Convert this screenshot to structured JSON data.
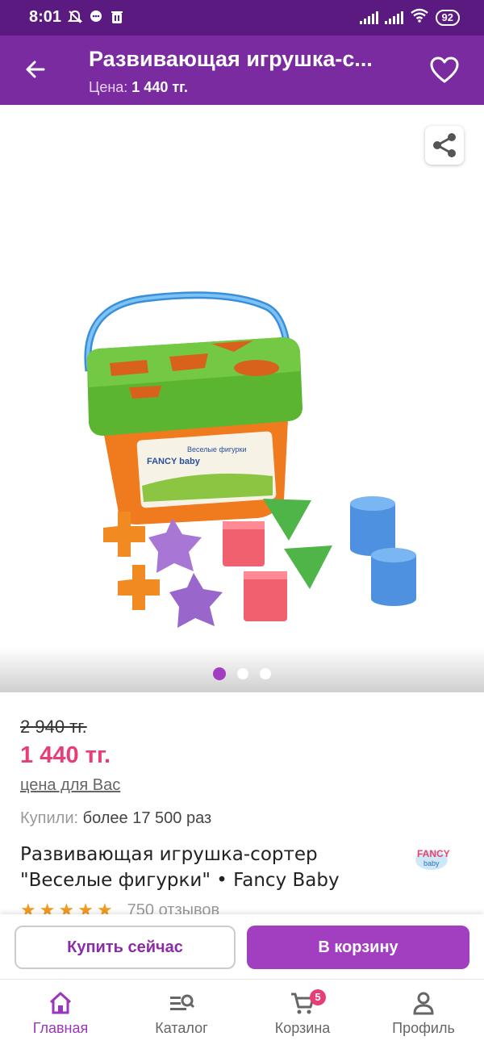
{
  "status_bar": {
    "time": "8:01",
    "battery": "92"
  },
  "header": {
    "title": "Развивающая игрушка-с...",
    "price_label": "Цена:",
    "price_value": "1 440 тг."
  },
  "gallery": {
    "image_brand_text": "FANCY baby",
    "image_caption": "Веселые фигурки",
    "dots_count": 3,
    "active_dot": 0
  },
  "product": {
    "old_price": "2 940 тг.",
    "price": "1 440 тг.",
    "your_price_label": "цена для Вас",
    "bought_label": "Купили:",
    "bought_value": "более 17 500 раз",
    "name_line1": "Развивающая игрушка-сортер",
    "name_line2": "\"Веселые фигурки\" • Fancy Baby",
    "rating_stars": 5,
    "reviews": "750 отзывов"
  },
  "actions": {
    "buy_now": "Купить сейчас",
    "add_to_cart": "В корзину"
  },
  "nav": {
    "items": [
      {
        "label": "Главная",
        "icon": "home-icon",
        "active": true
      },
      {
        "label": "Каталог",
        "icon": "catalog-search-icon",
        "active": false
      },
      {
        "label": "Корзина",
        "icon": "cart-icon",
        "active": false,
        "badge": "5"
      },
      {
        "label": "Профиль",
        "icon": "profile-icon",
        "active": false
      }
    ]
  },
  "colors": {
    "header": "#7b2ba0",
    "status": "#5a1a80",
    "accent": "#a13fc0",
    "price": "#e83e78"
  }
}
